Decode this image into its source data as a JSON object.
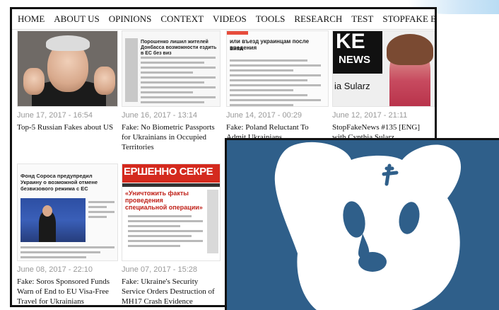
{
  "nav": {
    "items": [
      "HOME",
      "ABOUT US",
      "OPINIONS",
      "CONTEXT",
      "VIDEOS",
      "TOOLS",
      "RESEARCH",
      "TEST",
      "STOPFAKE BINGO GAME!"
    ]
  },
  "cards": [
    {
      "date": "June 17, 2017 - 16:54",
      "title": "Top-5 Russian Fakes about US"
    },
    {
      "date": "June 16, 2017 - 13:14",
      "title": "Fake: No Biometric Passports for Ukrainians in Occupied Territories"
    },
    {
      "date": "June 14, 2017 - 00:29",
      "title": "Fake: Poland Reluctant To Admit Ukrainians"
    },
    {
      "date": "June 12, 2017 - 21:11",
      "title": "StopFakeNews #135 [ENG] with Cynthia Sularz"
    },
    {
      "date": "June 08, 2017 - 22:10",
      "title": "Fake: Soros Sponsored Funds Warn of End to EU Visa-Free Travel for Ukrainians"
    },
    {
      "date": "June 07, 2017 - 15:28",
      "title": "Fake: Ukraine's Security Service Orders Destruction of MH17 Crash Evidence"
    }
  ],
  "thumbs": {
    "t2_heading": "Порошенко лишил жителей Донбасса возможности ездить в ЕС без виз",
    "t3_heading": "или въезд украинцам после введения",
    "t3_heading2": "виза",
    "t4_logo": "KE",
    "t4_news": "NEWS",
    "t4_name": "ia Sularz",
    "t5_heading": "Фонд Сороса предупредил Украину о возможной отмене безвизового режима с ЕС",
    "t6_masthead": "ЕРШЕННО СЕКРЕ",
    "t6_headline": "«Уничтожить факты проведения специальной операции»"
  },
  "colors": {
    "vk_bg": "#2f5f8a",
    "vk_dog": "#ffffff",
    "masthead_red": "#d42a1e"
  },
  "icons": {
    "vk_logo": "vk-sad-dog-logo-icon"
  }
}
